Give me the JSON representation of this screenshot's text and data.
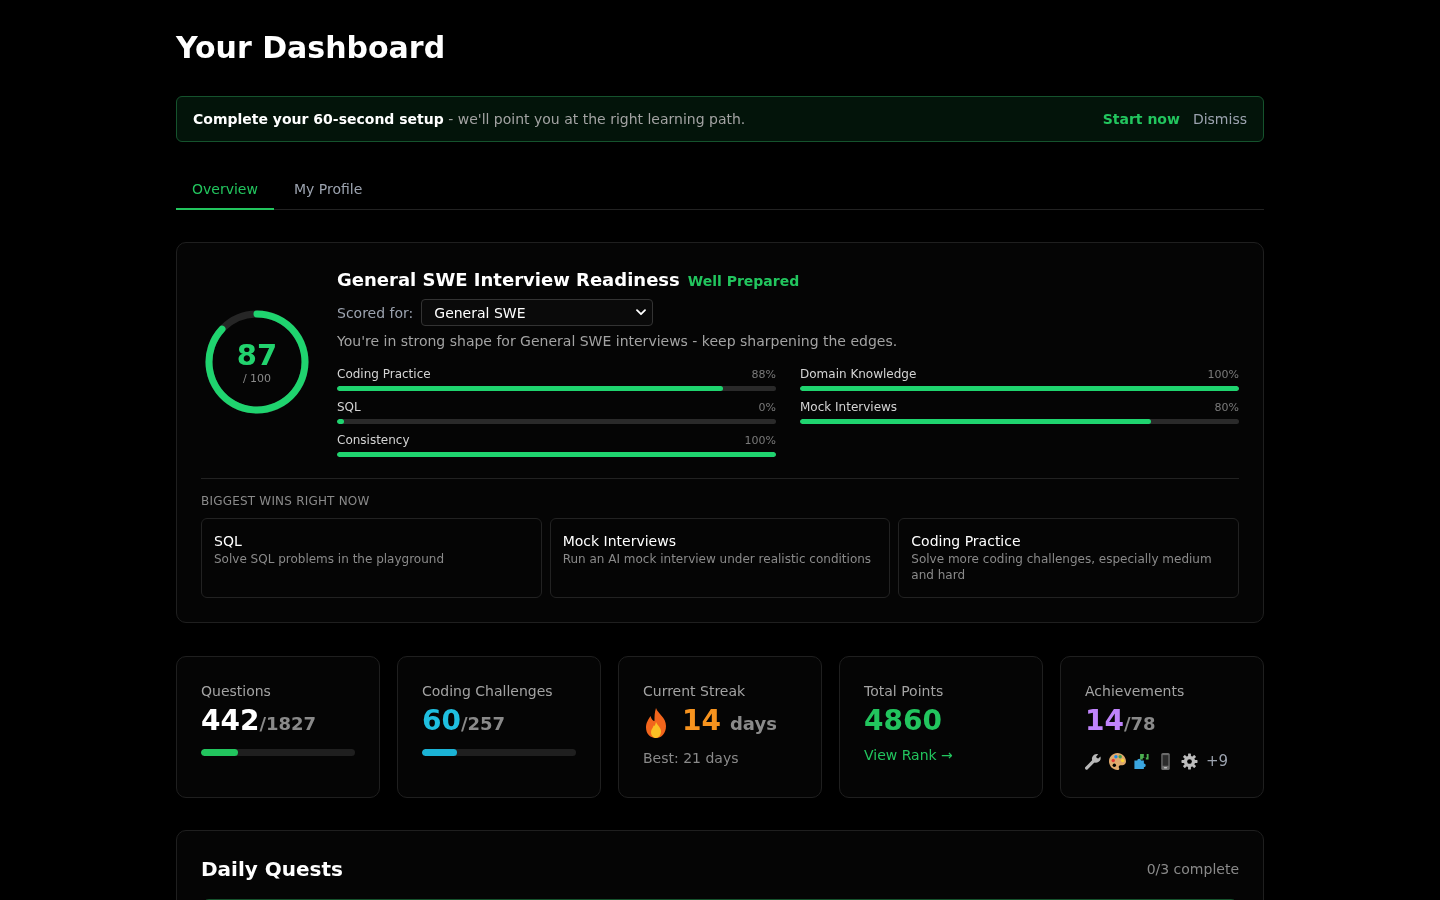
{
  "page_title": "Your Dashboard",
  "setup_banner": {
    "message": "**Complete your 60-second setup** - we'll point you at the right learning path.",
    "primary_action": "Start now",
    "dismiss": "Dismiss"
  },
  "tabs": [
    {
      "label": "Overview",
      "selected": true
    },
    {
      "label": "My Profile",
      "selected": false
    }
  ],
  "readiness": {
    "score": "87",
    "score_max": "/ 100",
    "level": 0.87,
    "title": "General SWE Interview Readiness",
    "badge": "Well Prepared",
    "scored_for_label": "Scored for:",
    "track_select": {
      "value": "General SWE"
    },
    "summary": "You're in strong shape for General SWE interviews - keep sharpening the edges.",
    "categories": [
      {
        "name": "Coding Practice",
        "reading": "88%",
        "level": 0.88
      },
      {
        "name": "Domain Knowledge",
        "reading": "100%",
        "level": 1
      },
      {
        "name": "SQL",
        "reading": "0%",
        "level": 0
      },
      {
        "name": "Mock Interviews",
        "reading": "80%",
        "level": 0.8
      },
      {
        "name": "Consistency",
        "reading": "100%",
        "level": 1
      }
    ],
    "wins_heading": "BIGGEST WINS RIGHT NOW",
    "wins": [
      {
        "title": "SQL",
        "description": "Solve SQL problems in the playground"
      },
      {
        "title": "Mock Interviews",
        "description": "Run an AI mock interview under realistic conditions"
      },
      {
        "title": "Coding Practice",
        "description": "Solve more coding challenges, especially medium and hard"
      }
    ]
  },
  "stats": [
    {
      "kind": "progress",
      "label": "Questions",
      "value": "442",
      "total": "/1827",
      "color": "#ffffff",
      "progress": {
        "level": 0.24,
        "color": "#22c55e"
      }
    },
    {
      "kind": "progress",
      "label": "Coding Challenges",
      "value": "60",
      "total": "/257",
      "color": "#1fbfe0",
      "progress": {
        "level": 0.23,
        "color": "#1bb3d6"
      }
    },
    {
      "kind": "streak",
      "label": "Current Streak",
      "value": "14",
      "unit": "days",
      "color": "#f7931e",
      "note": "Best: 21 days"
    },
    {
      "kind": "points",
      "label": "Total Points",
      "value": "4860",
      "color": "#22c55e",
      "link": "View Rank →"
    },
    {
      "kind": "achievements",
      "label": "Achievements",
      "value": "14",
      "total": "/78",
      "color": "#c084fc",
      "more": "+9"
    }
  ],
  "daily_quests": {
    "title": "Daily Quests",
    "completed_count": "0/3 complete"
  }
}
